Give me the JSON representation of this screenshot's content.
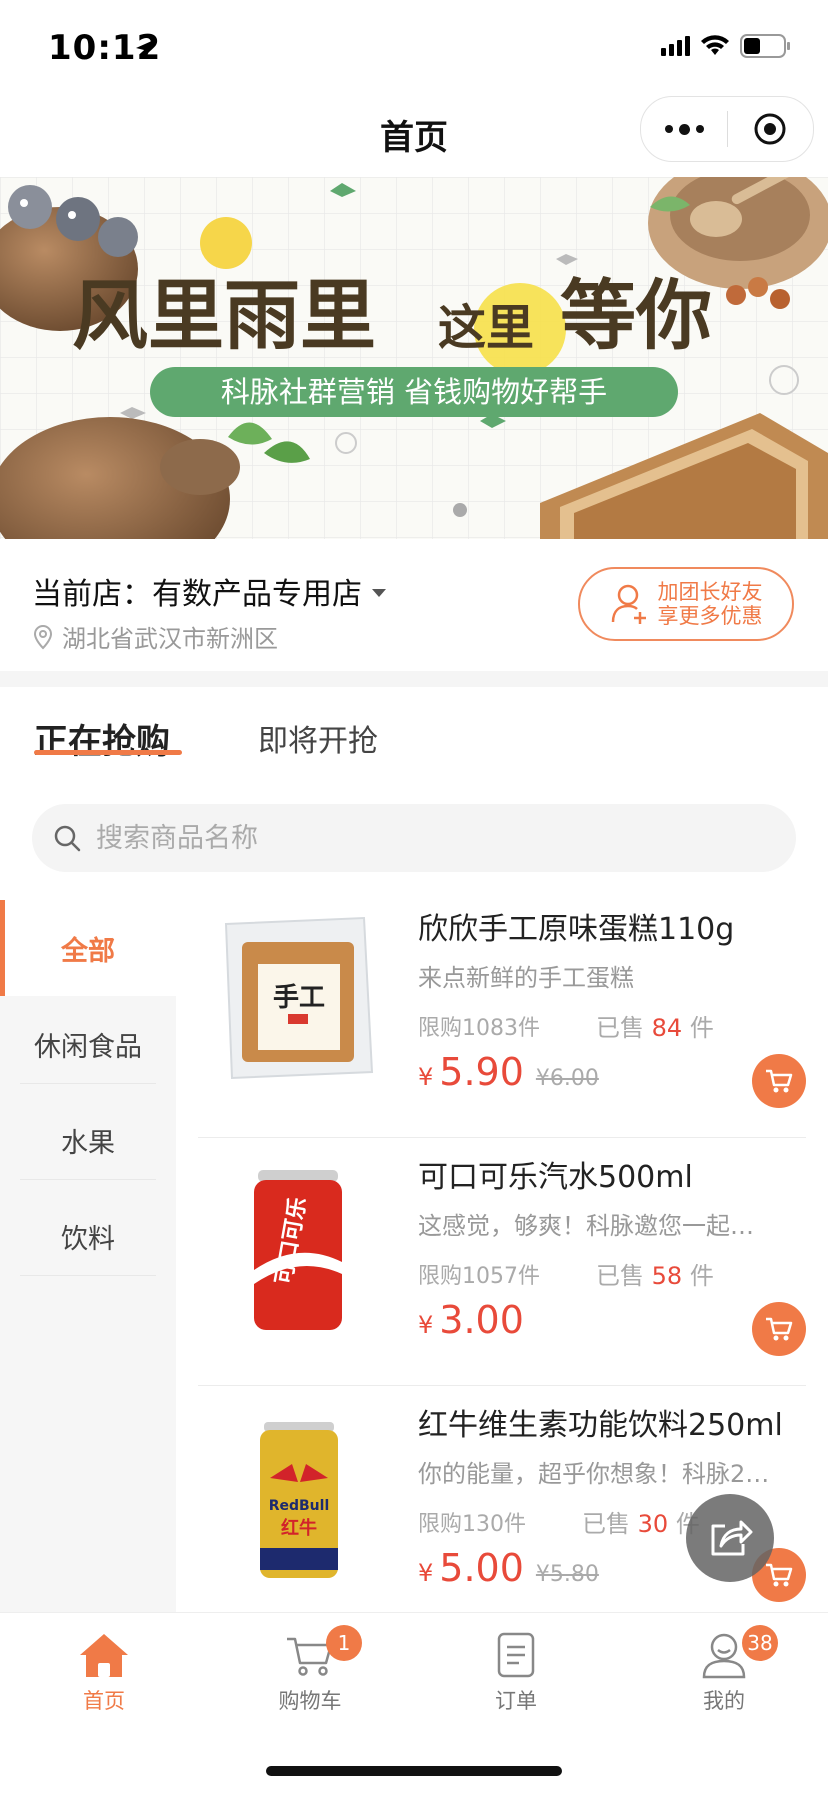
{
  "status_bar": {
    "time": "10:12"
  },
  "nav": {
    "title": "首页"
  },
  "banner": {
    "headline_a": "风里雨里",
    "headline_b": "这里",
    "headline_c": "等你",
    "slogan": "科脉社群营销 省钱购物好帮手"
  },
  "store": {
    "label": "当前店：",
    "name": "有数产品专用店",
    "address": "湖北省武汉市新洲区",
    "join_line1": "加团长好友",
    "join_line2": "享更多优惠"
  },
  "tabs": {
    "active": "正在抢购",
    "upcoming": "即将开抢"
  },
  "search": {
    "placeholder": "搜索商品名称"
  },
  "categories": [
    "全部",
    "休闲食品",
    "水果",
    "饮料"
  ],
  "products": [
    {
      "title": "欣欣手工原味蛋糕110g",
      "desc": "来点新鲜的手工蛋糕",
      "limit": "限购1083件",
      "sold_prefix": "已售",
      "sold_num": "84",
      "sold_suffix": "件",
      "currency": "¥",
      "price": "5.90",
      "orig_price": "¥6.00",
      "image": "cake-package"
    },
    {
      "title": "可口可乐汽水500ml",
      "desc": "这感觉，够爽！科脉邀您一起…",
      "limit": "限购1057件",
      "sold_prefix": "已售",
      "sold_num": "58",
      "sold_suffix": "件",
      "currency": "¥",
      "price": "3.00",
      "orig_price": "",
      "image": "cola-can"
    },
    {
      "title": "红牛维生素功能饮料250ml",
      "desc": "你的能量，超乎你想象！科脉2…",
      "limit": "限购130件",
      "sold_prefix": "已售",
      "sold_num": "30",
      "sold_suffix": "件",
      "currency": "¥",
      "price": "5.00",
      "orig_price": "¥5.80",
      "image": "redbull-can"
    }
  ],
  "product_image_text": {
    "cake_label": "手工",
    "cola_label": "可口可乐",
    "redbull_label": "RedBull",
    "redbull_cn": "红牛"
  },
  "tabbar": [
    {
      "label": "首页",
      "icon": "home-icon",
      "active": true,
      "badge": ""
    },
    {
      "label": "购物车",
      "icon": "cart-icon",
      "active": false,
      "badge": "1"
    },
    {
      "label": "订单",
      "icon": "order-icon",
      "active": false,
      "badge": ""
    },
    {
      "label": "我的",
      "icon": "user-icon",
      "active": false,
      "badge": "38"
    }
  ],
  "colors": {
    "accent": "#f07a47",
    "price": "#e84a3a",
    "banner_green": "#5fa86f",
    "banner_brown": "#4a3a22"
  }
}
